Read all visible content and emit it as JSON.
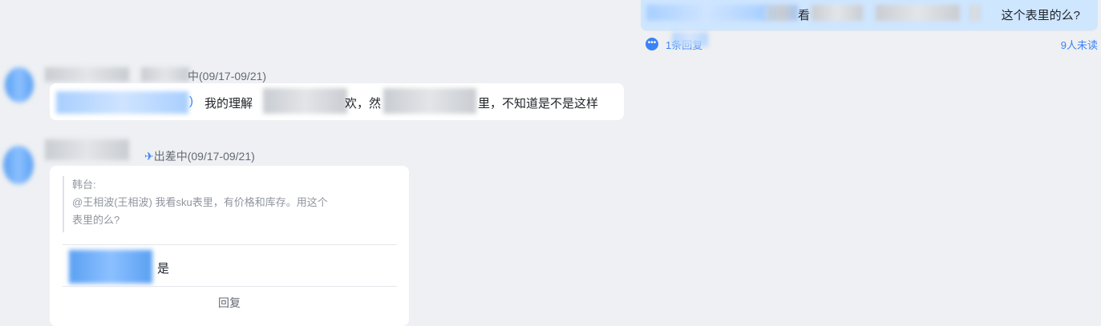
{
  "own_message": {
    "text_prefix": "看",
    "text_suffix": "这个表里的么?",
    "reply_count_label": "1条回复",
    "unread_label": "9人未读"
  },
  "message1": {
    "status": "中(09/17-09/21)",
    "seg1": ")",
    "seg2": "我的理解",
    "seg3": "欢，然",
    "seg4": "里，不知道是不是这样"
  },
  "message2": {
    "status": "出差中(09/17-09/21)",
    "quote_author": "韩台:",
    "quote_line1": "@王相波(王相波) 我看sku表里，有价格和库存。用这个",
    "quote_line2": "表里的么?",
    "reply_suffix": "是",
    "reply_button": "回复"
  }
}
